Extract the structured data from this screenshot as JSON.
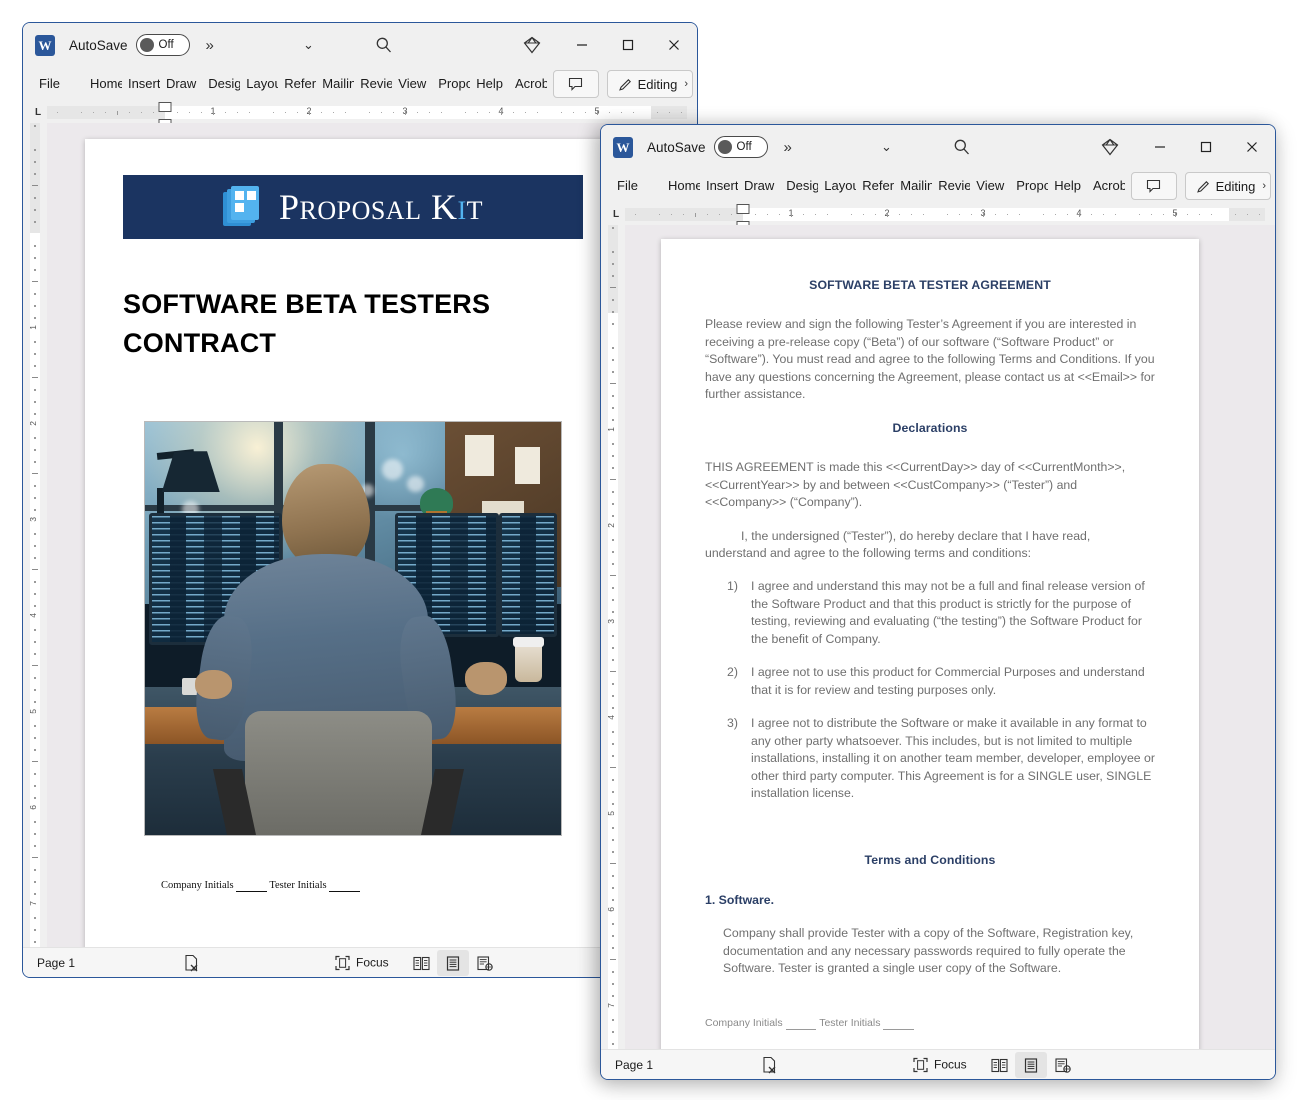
{
  "windows": [
    {
      "id": "word-window-1",
      "titlebar": {
        "app_icon": "word-icon",
        "app_letter": "W",
        "autosave_label": "AutoSave",
        "autosave_state": "Off",
        "more_icon": "chevron-double-right-icon",
        "caret_icon": "chevron-down-icon",
        "search_icon": "search-icon",
        "diamond_icon": "diamond-icon",
        "minimize_icon": "minimize-icon",
        "maximize_icon": "maximize-icon",
        "close_icon": "close-icon"
      },
      "ribbon": {
        "tabs": [
          "File",
          "Home",
          "Insert",
          "Draw",
          "Design",
          "Layout",
          "References",
          "Mailings",
          "Review",
          "View",
          "Proposal Kit",
          "Help",
          "Acrobat"
        ],
        "comment_label": "",
        "comment_icon": "comment-icon",
        "editing_label": "Editing",
        "editing_icon": "pencil-icon",
        "editing_caret": "›"
      },
      "ruler": {
        "corner_label": "L",
        "numbers": [
          "1",
          "2",
          "3",
          "4",
          "5"
        ]
      },
      "document": {
        "banner_title_main": "ROPOSAL",
        "banner_title_p": "P",
        "banner_title_k": "K",
        "banner_title_i": "I",
        "banner_title_t": "T",
        "banner_color": "#1b3461",
        "heading": "SOFTWARE BETA TESTERS CONTRACT",
        "image_alt": "developer-at-multi-monitor-desk-photo",
        "footer_company": "Company Initials",
        "footer_tester": "Tester Initials"
      },
      "statusbar": {
        "page_label": "Page 1",
        "proofing_icon": "proofing-errors-icon",
        "focus_label": "Focus",
        "focus_icon": "focus-icon",
        "view_read_icon": "read-mode-icon",
        "view_print_icon": "print-layout-icon",
        "view_web_icon": "web-layout-icon",
        "selected_view": "print-layout-icon"
      }
    },
    {
      "id": "word-window-2",
      "titlebar": {
        "app_icon": "word-icon",
        "app_letter": "W",
        "autosave_label": "AutoSave",
        "autosave_state": "Off",
        "more_icon": "chevron-double-right-icon",
        "caret_icon": "chevron-down-icon",
        "search_icon": "search-icon",
        "diamond_icon": "diamond-icon",
        "minimize_icon": "minimize-icon",
        "maximize_icon": "maximize-icon",
        "close_icon": "close-icon"
      },
      "ribbon": {
        "tabs": [
          "File",
          "Home",
          "Insert",
          "Draw",
          "Design",
          "Layout",
          "References",
          "Mailings",
          "Review",
          "View",
          "Proposal Kit",
          "Help",
          "Acrobat"
        ],
        "comment_label": "",
        "comment_icon": "comment-icon",
        "editing_label": "Editing",
        "editing_icon": "pencil-icon",
        "editing_caret": "›"
      },
      "ruler": {
        "corner_label": "L",
        "numbers": [
          "1",
          "2",
          "3",
          "4",
          "5"
        ]
      },
      "document": {
        "title": "SOFTWARE BETA TESTER AGREEMENT",
        "intro": "Please review and sign the following Tester’s Agreement if you are interested in receiving a pre-release copy (“Beta”) of our software (“Software Product” or “Software”). You must read and agree to the following Terms and Conditions. If you have any questions concerning the Agreement, please contact us at <<Email>> for further assistance.",
        "declarations_heading": "Declarations",
        "declarations_p1": "THIS AGREEMENT is made this <<CurrentDay>> day of <<CurrentMonth>>, <<CurrentYear>> by and between <<CustCompany>> (“Tester”) and <<Company>> (“Company”).",
        "declarations_p2": "I, the undersigned (“Tester”), do hereby declare that I have read, understand and agree to the following terms and conditions:",
        "list": [
          "I agree and understand this may not be a full and final release version of the Software Product and that this product is strictly for the purpose of testing, reviewing and evaluating (“the testing”) the Software Product for the benefit of Company.",
          "I agree not to use this product for Commercial Purposes and understand that it is for review and testing purposes only.",
          "I agree not to distribute the Software or make it available in any format to any other party whatsoever. This includes, but is not limited to multiple installations, installing it on another team member, developer, employee or other third party computer. This Agreement is for a SINGLE user, SINGLE installation license."
        ],
        "terms_heading": "Terms and Conditions",
        "section1_heading": "1. Software.",
        "section1_body": "Company shall provide Tester with a copy of the Software, Registration key, documentation and any necessary passwords required to fully operate the Software. Tester is granted a single user copy of the Software.",
        "footer_company": "Company Initials",
        "footer_tester": "Tester Initials"
      },
      "statusbar": {
        "page_label": "Page 1",
        "proofing_icon": "proofing-errors-icon",
        "focus_label": "Focus",
        "focus_icon": "focus-icon",
        "view_read_icon": "read-mode-icon",
        "view_print_icon": "print-layout-icon",
        "view_web_icon": "web-layout-icon",
        "selected_view": "print-layout-icon"
      }
    }
  ],
  "colors": {
    "word_blue": "#2b579a",
    "banner_navy": "#1b3461",
    "heading_navy": "#2b3f66",
    "body_gray": "#6f6f6f",
    "canvas_gray": "#ece9ec"
  }
}
